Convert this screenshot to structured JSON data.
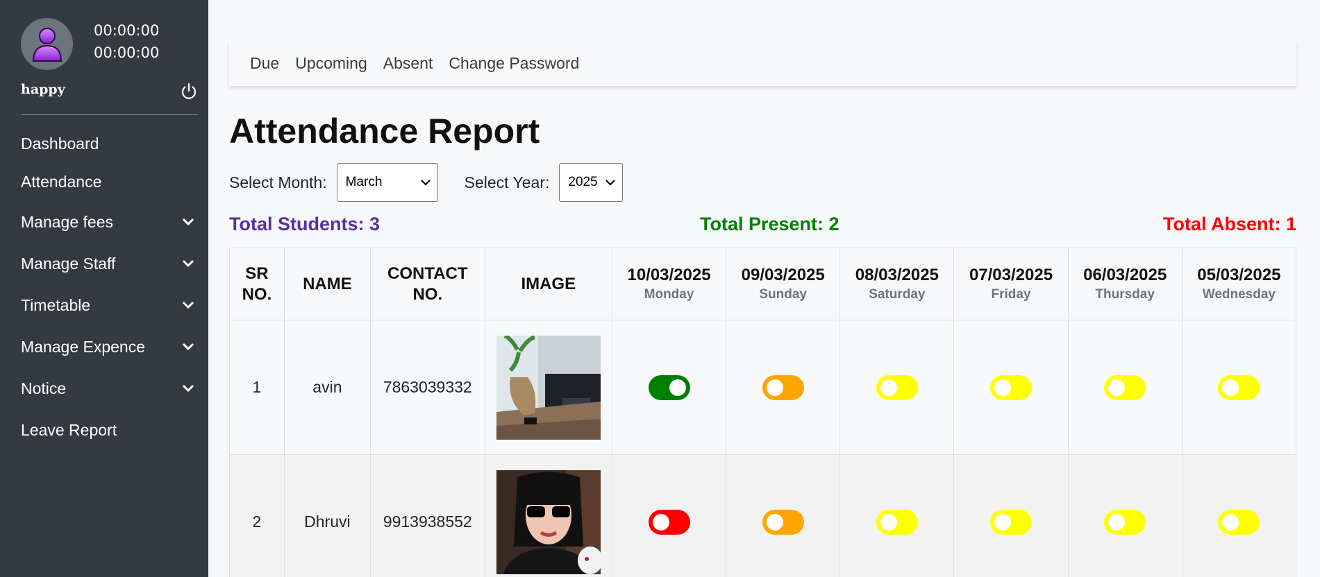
{
  "sidebar": {
    "timer_1": "00:00:00",
    "timer_2": "00:00:00",
    "username": "happy",
    "items": [
      {
        "label": "Dashboard",
        "dropdown": false
      },
      {
        "label": "Attendance",
        "dropdown": false
      },
      {
        "label": "Manage fees",
        "dropdown": true
      },
      {
        "label": "Manage Staff",
        "dropdown": true
      },
      {
        "label": "Timetable",
        "dropdown": true
      },
      {
        "label": "Manage Expence",
        "dropdown": true
      },
      {
        "label": "Notice",
        "dropdown": true
      },
      {
        "label": "Leave Report",
        "dropdown": false
      }
    ]
  },
  "topnav": {
    "links": [
      "Due",
      "Upcoming",
      "Absent",
      "Change Password"
    ]
  },
  "page": {
    "title": "Attendance Report",
    "month_label": "Select Month:",
    "month_value": "March",
    "year_label": "Select Year:",
    "year_value": "2025"
  },
  "totals": {
    "students": "Total Students: 3",
    "present": "Total Present: 2",
    "absent": "Total Absent: 1"
  },
  "table": {
    "headers": {
      "sr": "SR NO.",
      "name": "NAME",
      "contact": "CONTACT NO.",
      "image": "IMAGE"
    },
    "dates": [
      {
        "date": "10/03/2025",
        "day": "Monday"
      },
      {
        "date": "09/03/2025",
        "day": "Sunday"
      },
      {
        "date": "08/03/2025",
        "day": "Saturday"
      },
      {
        "date": "07/03/2025",
        "day": "Friday"
      },
      {
        "date": "06/03/2025",
        "day": "Thursday"
      },
      {
        "date": "05/03/2025",
        "day": "Wednesday"
      }
    ],
    "rows": [
      {
        "sr": "1",
        "name": "avin",
        "contact": "7863039332",
        "photo": "room-photo",
        "statuses": [
          "present",
          "holiday",
          "none",
          "none",
          "none",
          "none"
        ]
      },
      {
        "sr": "2",
        "name": "Dhruvi",
        "contact": "9913938552",
        "photo": "avatar-illustration",
        "statuses": [
          "absent",
          "holiday",
          "none",
          "none",
          "none",
          "none"
        ]
      }
    ]
  },
  "colors": {
    "sidebar_bg": "#343a40",
    "students": "#5b2e9e",
    "present": "#008000",
    "absent": "#ff0000",
    "toggle_present": "#008000",
    "toggle_absent": "#ff0000",
    "toggle_holiday": "#ffa500",
    "toggle_none": "#ffff00"
  }
}
